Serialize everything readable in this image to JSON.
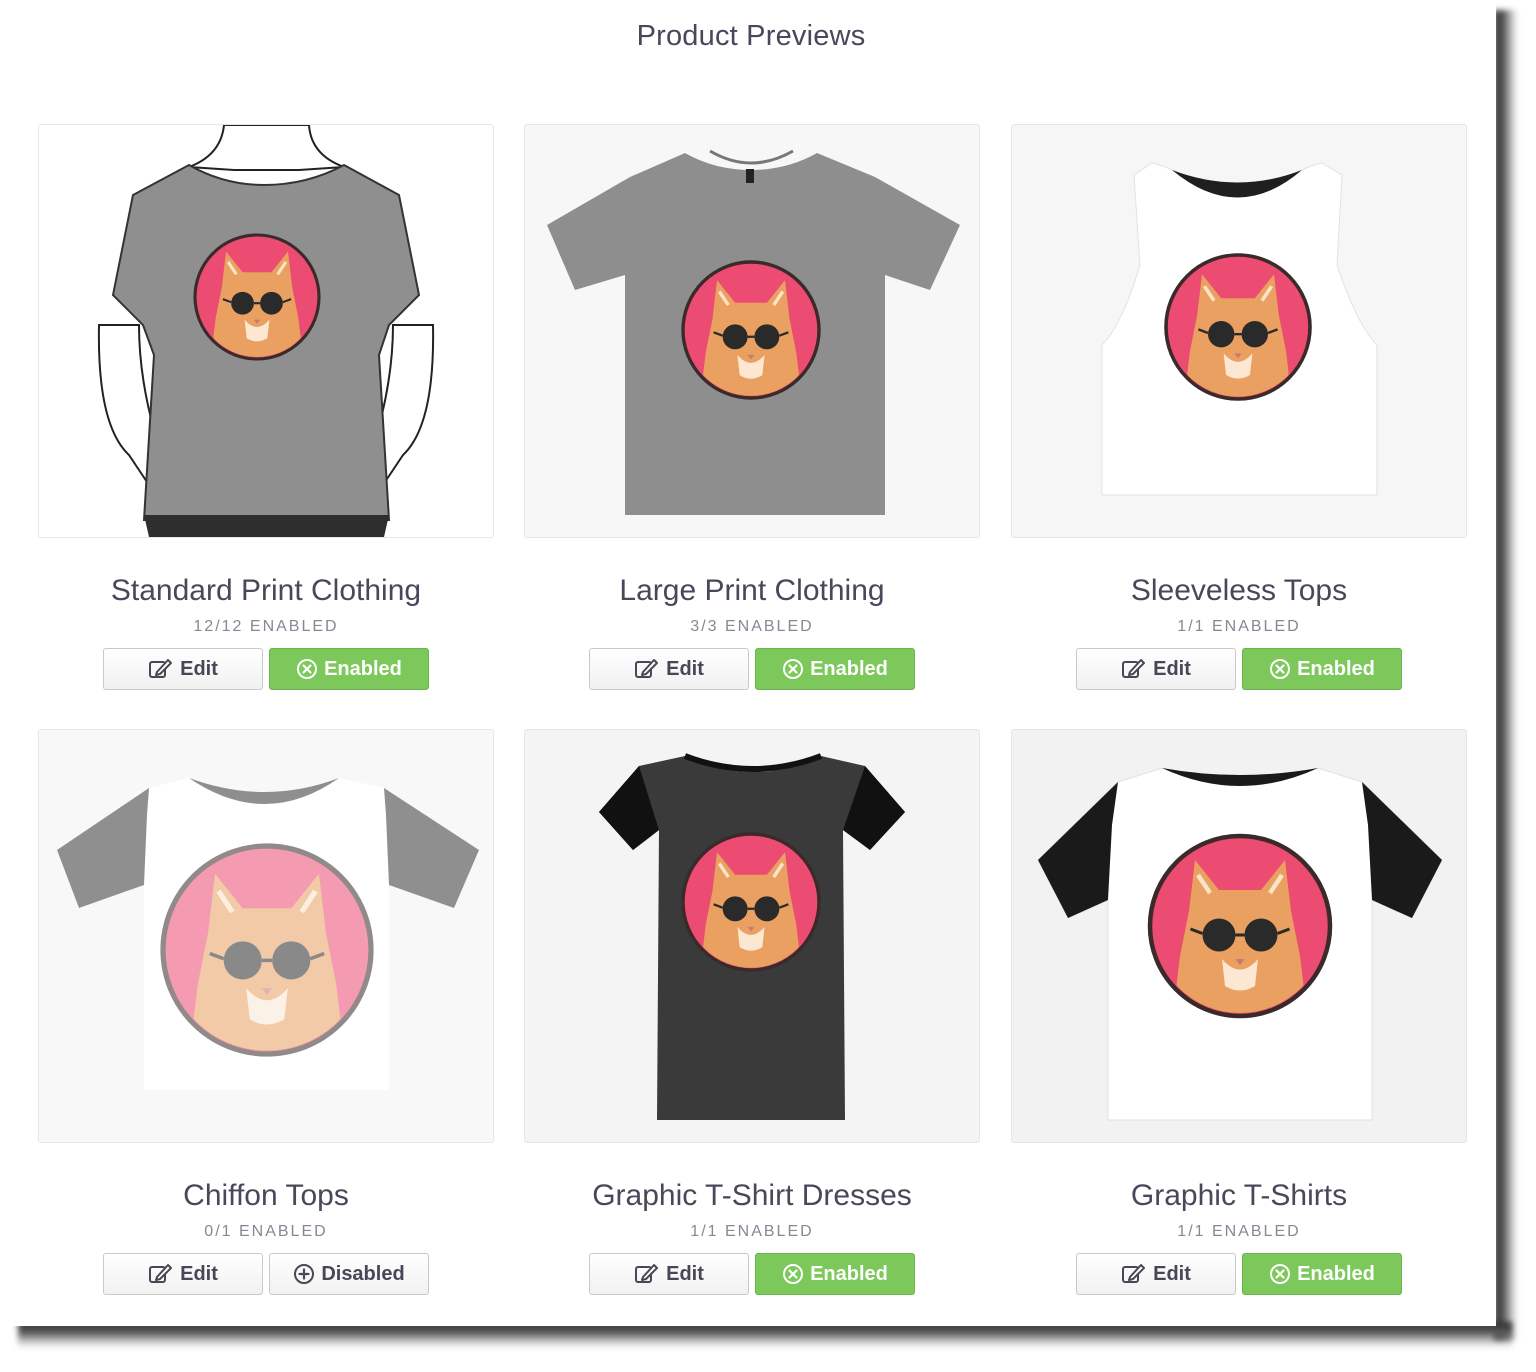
{
  "page": {
    "title": "Product Previews"
  },
  "colors": {
    "enabled_green": "#7cc85a",
    "text": "#4b475a",
    "muted": "#8a8795",
    "design_pink": "#ec4b72",
    "cat_orange": "#e9a060"
  },
  "products": [
    {
      "name": "Standard Print Clothing",
      "count": "12/12 ENABLED",
      "edit_label": "Edit",
      "status_label": "Enabled",
      "status": "enabled",
      "garment": "model-tee-heather"
    },
    {
      "name": "Large Print Clothing",
      "count": "3/3 ENABLED",
      "edit_label": "Edit",
      "status_label": "Enabled",
      "status": "enabled",
      "garment": "tee-heather"
    },
    {
      "name": "Sleeveless Tops",
      "count": "1/1 ENABLED",
      "edit_label": "Edit",
      "status_label": "Enabled",
      "status": "enabled",
      "garment": "sleeveless-white"
    },
    {
      "name": "Chiffon Tops",
      "count": "0/1 ENABLED",
      "edit_label": "Edit",
      "status_label": "Disabled",
      "status": "disabled",
      "garment": "chiffon-faded"
    },
    {
      "name": "Graphic T-Shirt Dresses",
      "count": "1/1 ENABLED",
      "edit_label": "Edit",
      "status_label": "Enabled",
      "status": "enabled",
      "garment": "dress-black"
    },
    {
      "name": "Graphic T-Shirts",
      "count": "1/1 ENABLED",
      "edit_label": "Edit",
      "status_label": "Enabled",
      "status": "enabled",
      "garment": "tee-white-black-sleeves"
    }
  ]
}
